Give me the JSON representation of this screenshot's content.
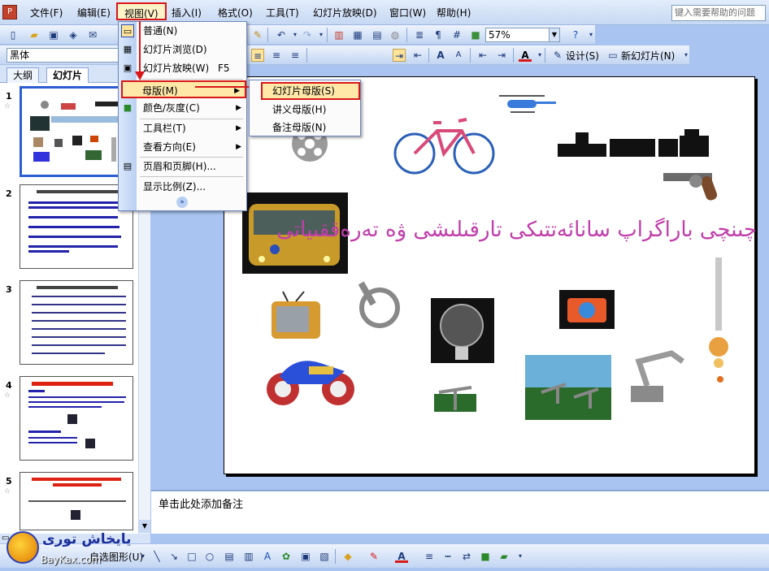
{
  "menubar": {
    "items": [
      "文件(F)",
      "编辑(E)",
      "视图(V)",
      "插入(I)",
      "格式(O)",
      "工具(T)",
      "幻灯片放映(D)",
      "窗口(W)",
      "帮助(H)"
    ],
    "help_placeholder": "键入需要帮助的问题"
  },
  "toolbar1": {
    "zoom": "57%"
  },
  "toolbar2": {
    "font": "黑体",
    "design": "设计(S)",
    "new_slide": "新幻灯片(N)"
  },
  "tabs": {
    "outline": "大纲",
    "slides": "幻灯片"
  },
  "thumbs": [
    {
      "num": "1"
    },
    {
      "num": "2"
    },
    {
      "num": "3"
    },
    {
      "num": "4"
    },
    {
      "num": "5"
    }
  ],
  "view_menu": {
    "items": [
      {
        "label": "普通(N)"
      },
      {
        "label": "幻灯片浏览(D)"
      },
      {
        "label": "幻灯片放映(W)",
        "shortcut": "F5"
      },
      {
        "label": "母版(M)"
      },
      {
        "label": "颜色/灰度(C)"
      },
      {
        "label": "工具栏(T)"
      },
      {
        "label": "查看方向(E)"
      },
      {
        "label": "页眉和页脚(H)..."
      },
      {
        "label": "显示比例(Z)..."
      }
    ]
  },
  "master_menu": {
    "items": [
      "幻灯片母版(S)",
      "讲义母版(H)",
      "备注母版(N)"
    ]
  },
  "slide": {
    "title": "ئۇچىنچى باراگراپ سانائەتتىكى تارقىلىشى ۋە تەرەققىياتى"
  },
  "notes": {
    "placeholder": "单击此处添加备注"
  },
  "drawbar": {
    "autoshape": "自选图形(U)"
  },
  "watermark": {
    "logo": "يايخاش تورى",
    "site": "BayKax.com"
  },
  "colors": {
    "accent_red": "#d81818",
    "menu_highlight": "#ffe8a8",
    "selection": "#2c5ed1"
  }
}
